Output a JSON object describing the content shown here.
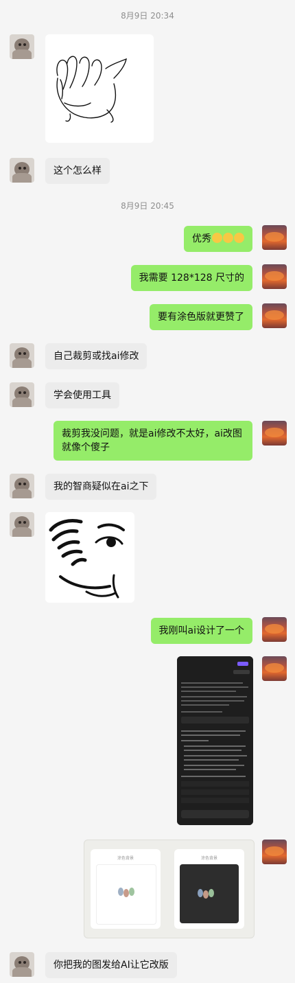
{
  "timestamps": [
    "8月9日 20:34",
    "8月9日 20:45"
  ],
  "messages": {
    "m1": "这个怎么样",
    "m2": "优秀",
    "m3": "我需要 128*128 尺寸的",
    "m4": "要有涂色版就更赞了",
    "m5": "自己裁剪或找ai修改",
    "m6": "学会使用工具",
    "m7_line1": "裁剪我没问题，就是ai修改不太好，ai改图",
    "m7_line2": "就像个傻子",
    "m8": "我的智商疑似在ai之下",
    "m9": "我刚叫ai设计了一个",
    "m10": "你把我的图发给AI让它改版"
  },
  "emoji_row": [
    "smile-emoji",
    "smile-emoji",
    "smile-emoji"
  ],
  "preview": {
    "card_left_title": "涂色背景",
    "card_right_title": "涂色背景"
  },
  "colors": {
    "outgoing_bubble": "#95ec69",
    "incoming_bubble": "#ececec",
    "background": "#f5f5f5"
  }
}
